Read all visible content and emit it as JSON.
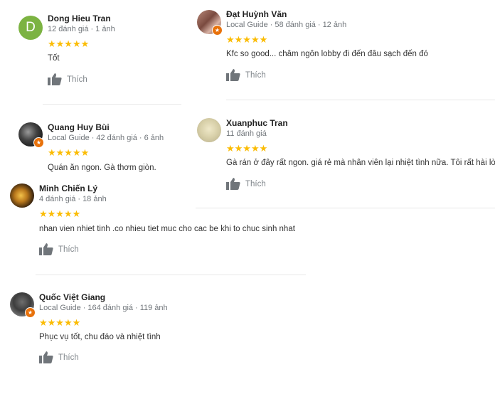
{
  "like_label": "Thích",
  "colors": {
    "star": "#fbbc04",
    "badge": "#e8710a",
    "avatar_d": "#7cb342"
  },
  "reviews": [
    {
      "name": "Dong Hieu Tran",
      "avatar_letter": "D",
      "meta": [
        "12 đánh giá",
        "1 ảnh"
      ],
      "stars": "★★★★★",
      "text": "Tốt"
    },
    {
      "name": "Đạt Huỳnh Văn",
      "meta": [
        "Local Guide",
        "58 đánh giá",
        "12 ảnh"
      ],
      "stars": "★★★★★",
      "text": "Kfc so good... châm ngôn lobby đi đến đâu sạch đến đó"
    },
    {
      "name": "Quang Huy Bùi",
      "meta": [
        "Local Guide",
        "42 đánh giá",
        "6 ảnh"
      ],
      "stars": "★★★★★",
      "text": "Quán ăn ngon. Gà thơm giòn."
    },
    {
      "name": "Xuanphuc Tran",
      "meta": [
        "11 đánh giá"
      ],
      "stars": "★★★★★",
      "text": "Gà rán ở đây rất ngon. giá rẻ mà nhân viên lại nhiệt tình nữa. Tôi rất hài lò"
    },
    {
      "name": "Minh Chiến Lý",
      "meta": [
        "4 đánh giá",
        "18 ảnh"
      ],
      "stars": "★★★★★",
      "text": "nhan vien nhiet tinh .co nhieu tiet muc cho cac be khi to chuc sinh nhat"
    },
    {
      "name": "Quốc Việt Giang",
      "meta": [
        "Local Guide",
        "164 đánh giá",
        "119 ảnh"
      ],
      "stars": "★★★★★",
      "text": "Phục vụ tốt, chu đáo và nhiệt tình"
    }
  ]
}
